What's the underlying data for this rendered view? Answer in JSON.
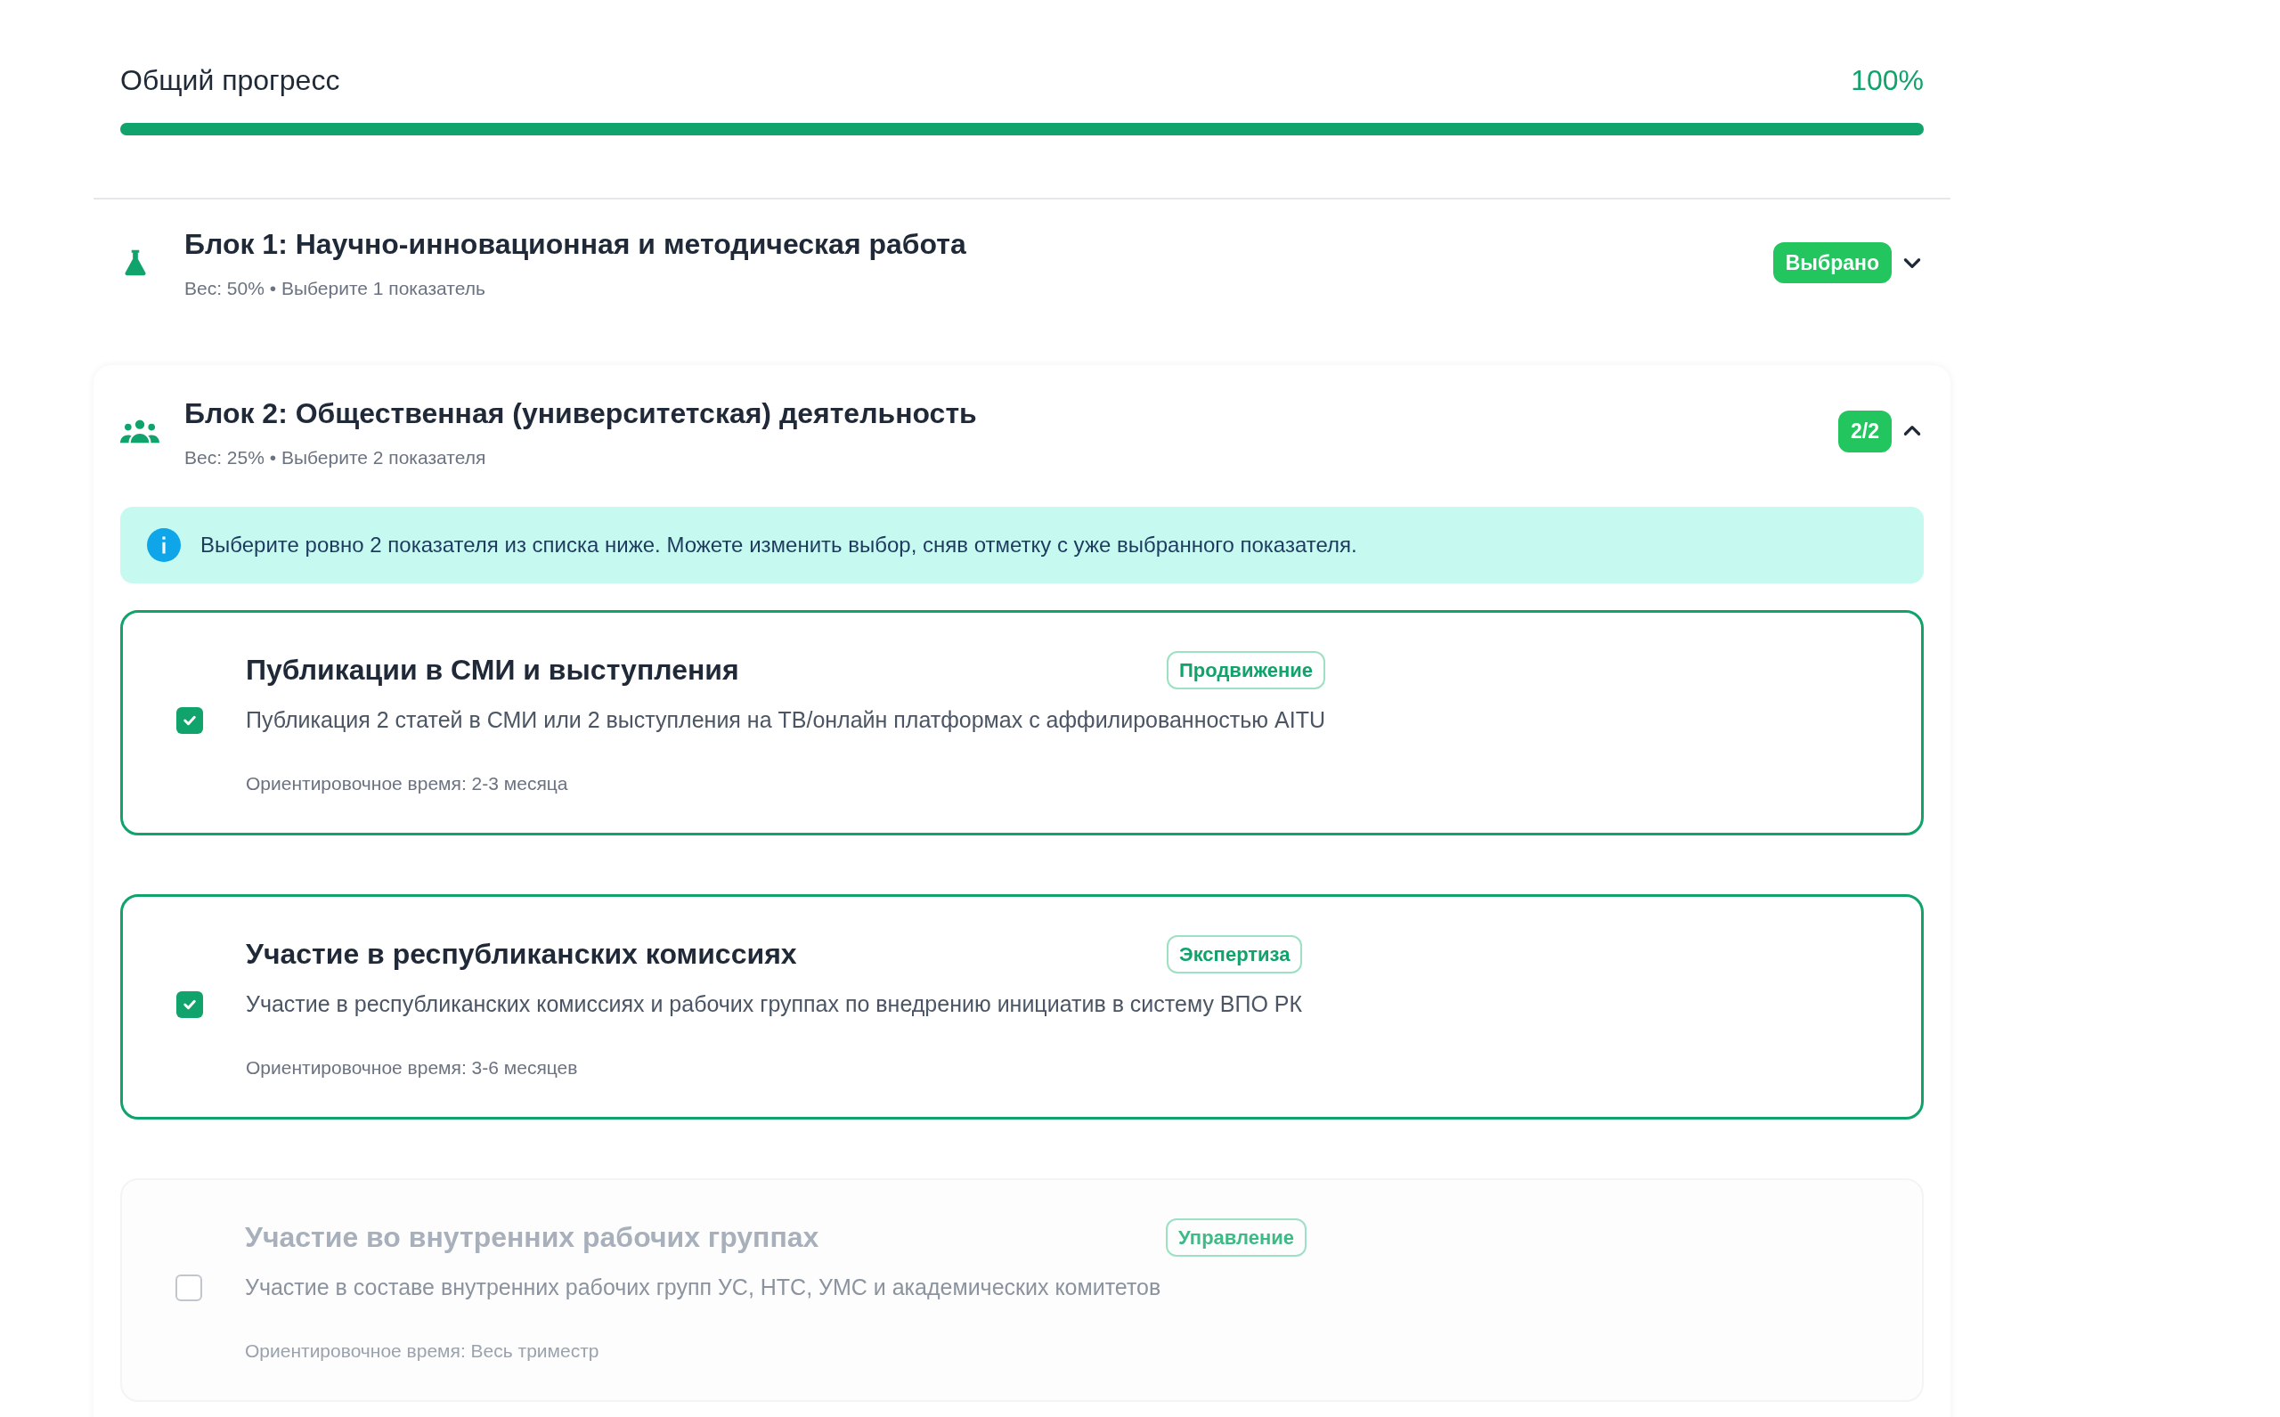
{
  "progress": {
    "label": "Общий прогресс",
    "reading": "100%",
    "level": 1
  },
  "blocks": [
    {
      "kind": "flask",
      "title": "Блок 1: Научно-инновационная и методическая работа",
      "subtitle": "Вес: 50% • Выберите 1 показатель",
      "badge": "Выбрано",
      "expanded": false
    },
    {
      "kind": "people",
      "title": "Блок 2: Общественная (университетская) деятельность",
      "subtitle": "Вес: 25% • Выберите 2 показателя",
      "badge": "2/2",
      "expanded": true,
      "info": "Выберите ровно 2 показателя из списка ниже. Можете изменить выбор, сняв отметку с уже выбранного показателя.",
      "items": [
        {
          "title": "Публикации в СМИ и выступления",
          "tag": "Продвижение",
          "description": "Публикация 2 статей в СМИ или 2 выступления на ТВ/онлайн платформах с аффилированностью AITU",
          "time": "Ориентировочное время: 2-3 месяца",
          "checked": true,
          "disabled": false
        },
        {
          "title": "Участие в республиканских комиссиях",
          "tag": "Экспертиза",
          "description": "Участие в республиканских комиссиях и рабочих группах по внедрению инициатив в систему ВПО РК",
          "time": "Ориентировочное время: 3-6 месяцев",
          "checked": true,
          "disabled": false
        },
        {
          "title": "Участие во внутренних рабочих группах",
          "tag": "Управление",
          "description": "Участие в составе внутренних рабочих групп УС, НТС, УМС и академических комитетов",
          "time": "Ориентировочное время: Весь триместр",
          "checked": false,
          "disabled": true
        }
      ]
    }
  ]
}
